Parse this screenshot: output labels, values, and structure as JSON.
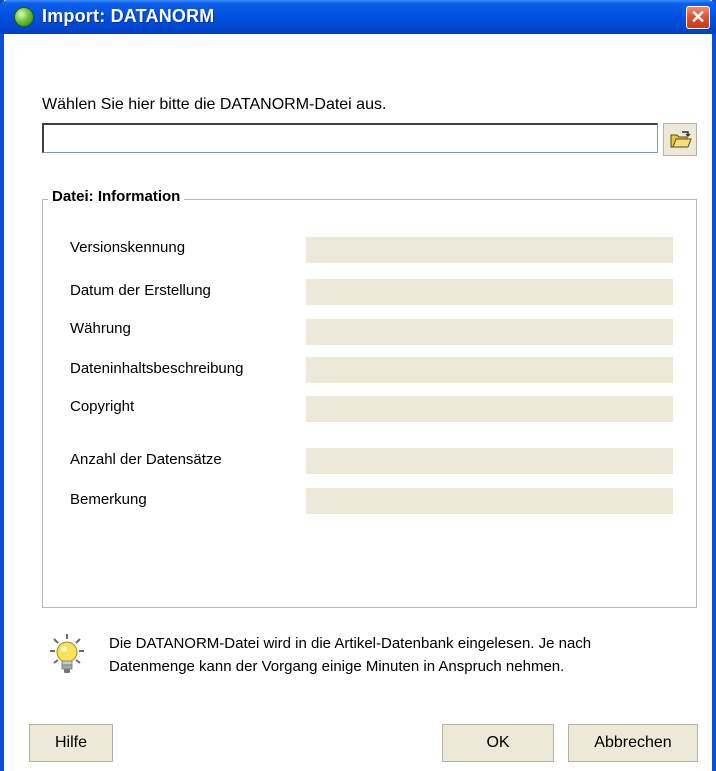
{
  "window": {
    "title": "Import: DATANORM",
    "close_glyph": "✕"
  },
  "file": {
    "prompt": "Wählen Sie hier bitte die DATANORM-Datei aus.",
    "value": "",
    "placeholder": ""
  },
  "info_group": {
    "legend": "Datei: Information",
    "fields": [
      {
        "label": "Versionskennung",
        "value": ""
      },
      {
        "label": "Datum der Erstellung",
        "value": ""
      },
      {
        "label": "Währung",
        "value": ""
      },
      {
        "label": "Dateninhaltsbeschreibung",
        "value": ""
      },
      {
        "label": "Copyright",
        "value": ""
      },
      {
        "label": "Anzahl der Datensätze",
        "value": ""
      },
      {
        "label": "Bemerkung",
        "value": ""
      }
    ]
  },
  "notice": {
    "line1": "Die DATANORM-Datei wird in die Artikel-Datenbank eingelesen. Je nach",
    "line2": "Datenmenge kann der Vorgang einige Minuten in Anspruch nehmen."
  },
  "buttons": {
    "help": "Hilfe",
    "ok": "OK",
    "cancel": "Abbrechen"
  },
  "icons": {
    "title": "app-globe-icon",
    "close": "close-icon",
    "browse": "folder-open-icon",
    "notice": "lightbulb-icon"
  },
  "colors": {
    "titlebar": "#0050e0",
    "frame": "#0a4fd8",
    "close": "#e0502a",
    "readonly_field": "#ece9d8",
    "button_face": "#ece9d8"
  }
}
